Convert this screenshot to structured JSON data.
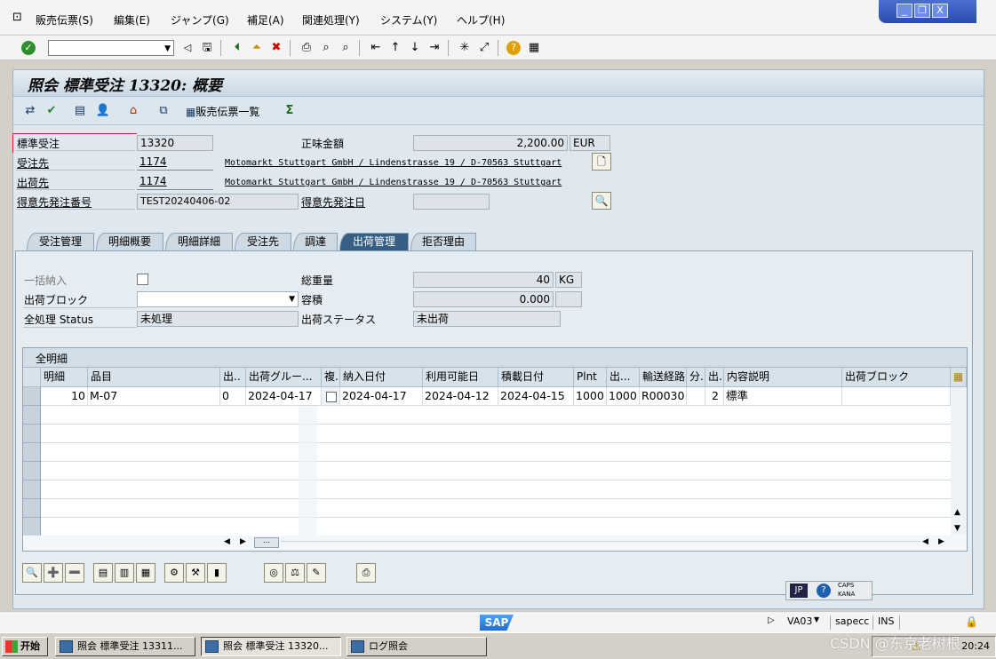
{
  "menu": {
    "items": [
      "販売伝票(S)",
      "編集(E)",
      "ジャンプ(G)",
      "補足(A)",
      "関連処理(Y)",
      "システム(Y)",
      "ヘルプ(H)"
    ]
  },
  "window": {
    "minimize": "_",
    "restore": "❐",
    "close": "X"
  },
  "command_field": {
    "value": ""
  },
  "page": {
    "title": "照会 標準受注 13320: 概要"
  },
  "app_toolbar": {
    "sales_doc_list": "販売伝票一覧"
  },
  "header": {
    "order_type_label": "標準受注",
    "order_number": "13320",
    "net_value_label": "正味金額",
    "net_value": "2,200.00",
    "currency": "EUR",
    "sold_to_label": "受注先",
    "sold_to_number": "1174",
    "sold_to_address": "Motomarkt Stuttgart GmbH / Lindenstrasse 19 / D-70563 Stuttgart",
    "ship_to_label": "出荷先",
    "ship_to_number": "1174",
    "ship_to_address": "Motomarkt Stuttgart GmbH / Lindenstrasse 19 / D-70563 Stuttgart",
    "po_number_label": "得意先発注番号",
    "po_number": "TEST20240406-02",
    "po_date_label": "得意先発注日",
    "po_date": ""
  },
  "tabs": [
    "受注管理",
    "明細概要",
    "明細詳細",
    "受注先",
    "調達",
    "出荷管理",
    "拒否理由"
  ],
  "active_tab": "出荷管理",
  "shipping": {
    "complete_delivery_label": "一括納入",
    "total_weight_label": "総重量",
    "total_weight": "40",
    "weight_unit": "KG",
    "delivery_block_label": "出荷ブロック",
    "delivery_block": "",
    "volume_label": "容積",
    "volume": "0.000",
    "volume_unit": "",
    "overall_status_label": "全処理 Status",
    "overall_status": "未処理",
    "delivery_status_label": "出荷ステータス",
    "delivery_status": "未出荷"
  },
  "items_table": {
    "caption": "全明細",
    "columns": [
      "明細",
      "品目",
      "出..",
      "出荷グルー...",
      "複.",
      "納入日付",
      "利用可能日",
      "積載日付",
      "Plnt",
      "出...",
      "輸送経路",
      "分.",
      "出.",
      "内容説明",
      "出荷ブロック"
    ],
    "rows": [
      [
        "10",
        "M-07",
        "0",
        "2024-04-17",
        "",
        "2024-04-17",
        "2024-04-12",
        "2024-04-15",
        "1000",
        "1000",
        "R00030",
        "",
        "2",
        "標準",
        ""
      ]
    ]
  },
  "ime": {
    "lang": "JP",
    "caps": "CAPS",
    "kana": "KANA"
  },
  "status_bar": {
    "logo": "SAP",
    "transaction": "VA03",
    "server": "sapecc",
    "mode": "INS"
  },
  "taskbar": {
    "start": "开始",
    "tasks": [
      "照会 標準受注 13311...",
      "照会 標準受注 13320...",
      "ログ照会"
    ],
    "clock": "20:24",
    "watermark": "CSDN @东京老树根"
  }
}
